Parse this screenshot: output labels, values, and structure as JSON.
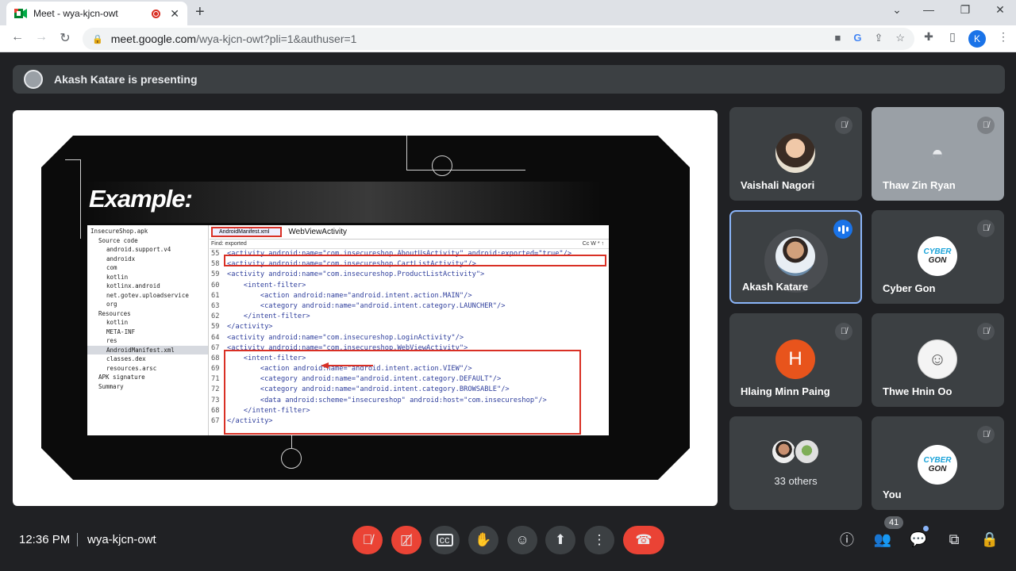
{
  "browser": {
    "tab_title": "Meet - wya-kjcn-owt",
    "url_host": "meet.google.com",
    "url_path": "/wya-kjcn-owt?pli=1&authuser=1",
    "profile_initial": "K"
  },
  "banner": {
    "text": "Akash Katare is presenting"
  },
  "slide": {
    "title": "Example:",
    "editor_tab_active": "AndroidManifest.xml",
    "editor_tab_other": "WebViewActivity",
    "find_label": "Find: exported",
    "find_tools": "Cc  W  *  ↑",
    "tree": [
      "InsecureShop.apk",
      "Source code",
      "android.support.v4",
      "androidx",
      "com",
      "kotlin",
      "kotlinx.android",
      "net.gotev.uploadservice",
      "org",
      "Resources",
      "kotlin",
      "META-INF",
      "res",
      "AndroidManifest.xml",
      "classes.dex",
      "resources.arsc",
      "APK signature",
      "Summary"
    ],
    "code": [
      {
        "ln": "55",
        "text": "<activity android:name=\"com.insecureshop.AboutUsActivity\" android:exported=\"true\"/>"
      },
      {
        "ln": "58",
        "text": "<activity android:name=\"com.insecureshop.CartListActivity\"/>"
      },
      {
        "ln": "59",
        "text": "<activity android:name=\"com.insecureshop.ProductListActivity\">"
      },
      {
        "ln": "60",
        "text": "    <intent-filter>"
      },
      {
        "ln": "61",
        "text": "        <action android:name=\"android.intent.action.MAIN\"/>"
      },
      {
        "ln": "63",
        "text": "        <category android:name=\"android.intent.category.LAUNCHER\"/>"
      },
      {
        "ln": "62",
        "text": "    </intent-filter>"
      },
      {
        "ln": "59",
        "text": "</activity>"
      },
      {
        "ln": "64",
        "text": "<activity android:name=\"com.insecureshop.LoginActivity\"/>"
      },
      {
        "ln": "67",
        "text": "<activity android:name=\"com.insecureshop.WebViewActivity\">"
      },
      {
        "ln": "68",
        "text": "    <intent-filter>"
      },
      {
        "ln": "69",
        "text": "        <action android:name=\"android.intent.action.VIEW\"/>"
      },
      {
        "ln": "71",
        "text": "        <category android:name=\"android.intent.category.DEFAULT\"/>"
      },
      {
        "ln": "72",
        "text": "        <category android:name=\"android.intent.category.BROWSABLE\"/>"
      },
      {
        "ln": "73",
        "text": "        <data android:scheme=\"insecureshop\" android:host=\"com.insecureshop\"/>"
      },
      {
        "ln": "68",
        "text": "    </intent-filter>"
      },
      {
        "ln": "67",
        "text": "</activity>"
      }
    ]
  },
  "participants": [
    {
      "name": "Vaishali Nagori",
      "muted": true
    },
    {
      "name": "Thaw Zin Ryan",
      "muted": true
    },
    {
      "name": "Akash Katare",
      "speaking": true
    },
    {
      "name": "Cyber Gon",
      "muted": true
    },
    {
      "name": "Hlaing Minn Paing",
      "muted": true,
      "initial": "H"
    },
    {
      "name": "Thwe Hnin Oo",
      "muted": true
    },
    {
      "name": "33 others"
    },
    {
      "name": "You",
      "muted": true
    }
  ],
  "cyber_logo": {
    "line1": "CYBER",
    "line2": "GON"
  },
  "bottom": {
    "time": "12:36 PM",
    "meeting_code": "wya-kjcn-owt",
    "people_count": "41"
  },
  "colors": {
    "accent": "#1a73e8",
    "end_call": "#ea4335",
    "tile_bg": "#3c4043",
    "highlight": "#d93025"
  }
}
